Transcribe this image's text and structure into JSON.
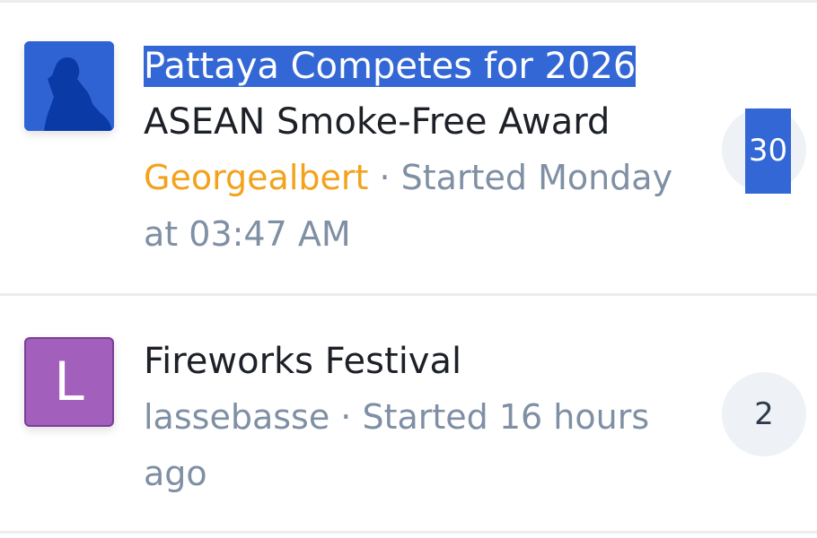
{
  "threads": [
    {
      "title_selected": "Pattaya Competes for 2026",
      "title_rest": "ASEAN Smoke-Free Award",
      "author": "Georgealbert",
      "separator": " · ",
      "started": "Started Monday at 03:47 AM",
      "reply_count": "30",
      "avatar_icon": "user-silhouette-icon",
      "avatar_color": "#2f63d4"
    },
    {
      "title": "Fireworks Festival",
      "author": "lassebasse",
      "separator": " · ",
      "started": "Started 16 hours ago",
      "reply_count": "2",
      "avatar_letter": "L",
      "avatar_color": "#a25fbc"
    }
  ],
  "colors": {
    "selection": "#3467d6",
    "author_highlight": "#f3a21c",
    "meta_text": "#7f8fa4",
    "title_text": "#1d2127"
  }
}
